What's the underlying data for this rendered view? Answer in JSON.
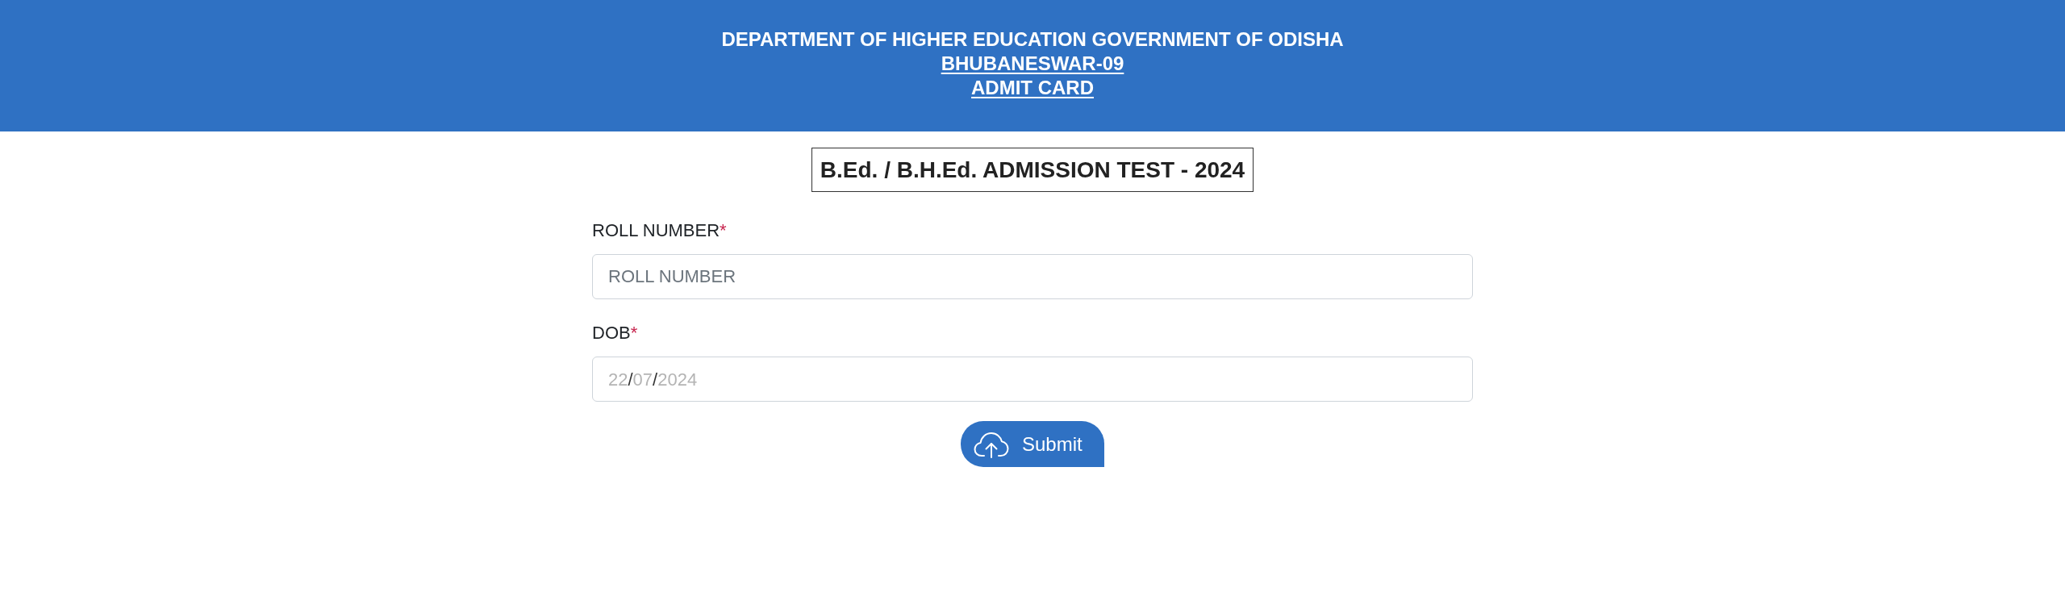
{
  "header": {
    "lines": [
      {
        "text": "DEPARTMENT OF HIGHER EDUCATION GOVERNMENT OF ODISHA",
        "underlined": false
      },
      {
        "text": "BHUBANESWAR-09",
        "underlined": true
      },
      {
        "text": "ADMIT CARD",
        "underlined": true
      }
    ]
  },
  "form": {
    "title": "B.Ed. / B.H.Ed. ADMISSION TEST - 2024",
    "fields": [
      {
        "kind": "text",
        "label": "ROLL NUMBER",
        "required_mark": "*",
        "placeholder": "ROLL NUMBER"
      },
      {
        "kind": "date",
        "label": "DOB",
        "required_mark": "*",
        "placeholder_parts": [
          {
            "kind": "digits",
            "text": "22"
          },
          {
            "kind": "separator",
            "text": "/"
          },
          {
            "kind": "digits",
            "text": "07"
          },
          {
            "kind": "separator",
            "text": "/"
          },
          {
            "kind": "digits",
            "text": "2024"
          }
        ]
      }
    ],
    "submit": {
      "label": "Submit"
    }
  }
}
